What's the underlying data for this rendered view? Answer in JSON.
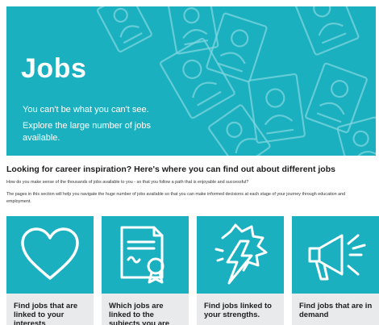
{
  "hero": {
    "title": "Jobs",
    "line1": "You can't be what you can't see.",
    "line2": "Explore the large number of jobs available."
  },
  "intro": {
    "heading": "Looking for career inspiration? Here's where you can find out about different jobs",
    "paragraph1": "How do you make sense of the thousands of jobs available to you - so that you follow a path that is enjoyable and successful?",
    "paragraph2": "The pages in this section will help you navigate the huge number of jobs available so that you can make informed decisions at each stage of your journey through education and employment."
  },
  "cards": [
    {
      "label": "Find jobs that are linked to your interests",
      "icon": "heart-icon"
    },
    {
      "label": "Which jobs are linked to the subjects you are",
      "icon": "certificate-icon"
    },
    {
      "label": "Find jobs linked to your strengths.",
      "icon": "lightning-icon"
    },
    {
      "label": "Find jobs that are in demand",
      "icon": "megaphone-icon"
    }
  ],
  "colors": {
    "brand": "#1ab0bf",
    "card_background": "#e8eaec"
  }
}
